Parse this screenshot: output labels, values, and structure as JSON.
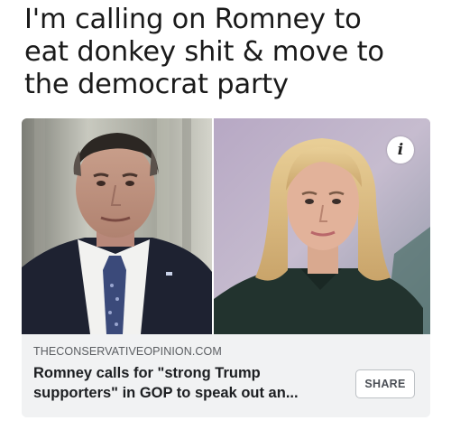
{
  "post": {
    "text_lines": [
      "I'm calling on Romney to",
      "eat donkey shit & move to",
      "the democrat party"
    ]
  },
  "link_card": {
    "info_icon": "i",
    "domain": "THECONSERVATIVEOPINION.COM",
    "title_lines": [
      "Romney calls for \"strong Trump",
      "supporters\" in GOP to speak out an..."
    ],
    "share_label": "SHARE"
  },
  "icons": {
    "info": "info-icon"
  },
  "colors": {
    "card_background": "#f1f2f3",
    "domain_text": "#5a5d61",
    "title_text": "#1c1e21",
    "share_border": "#bcc0c4"
  }
}
